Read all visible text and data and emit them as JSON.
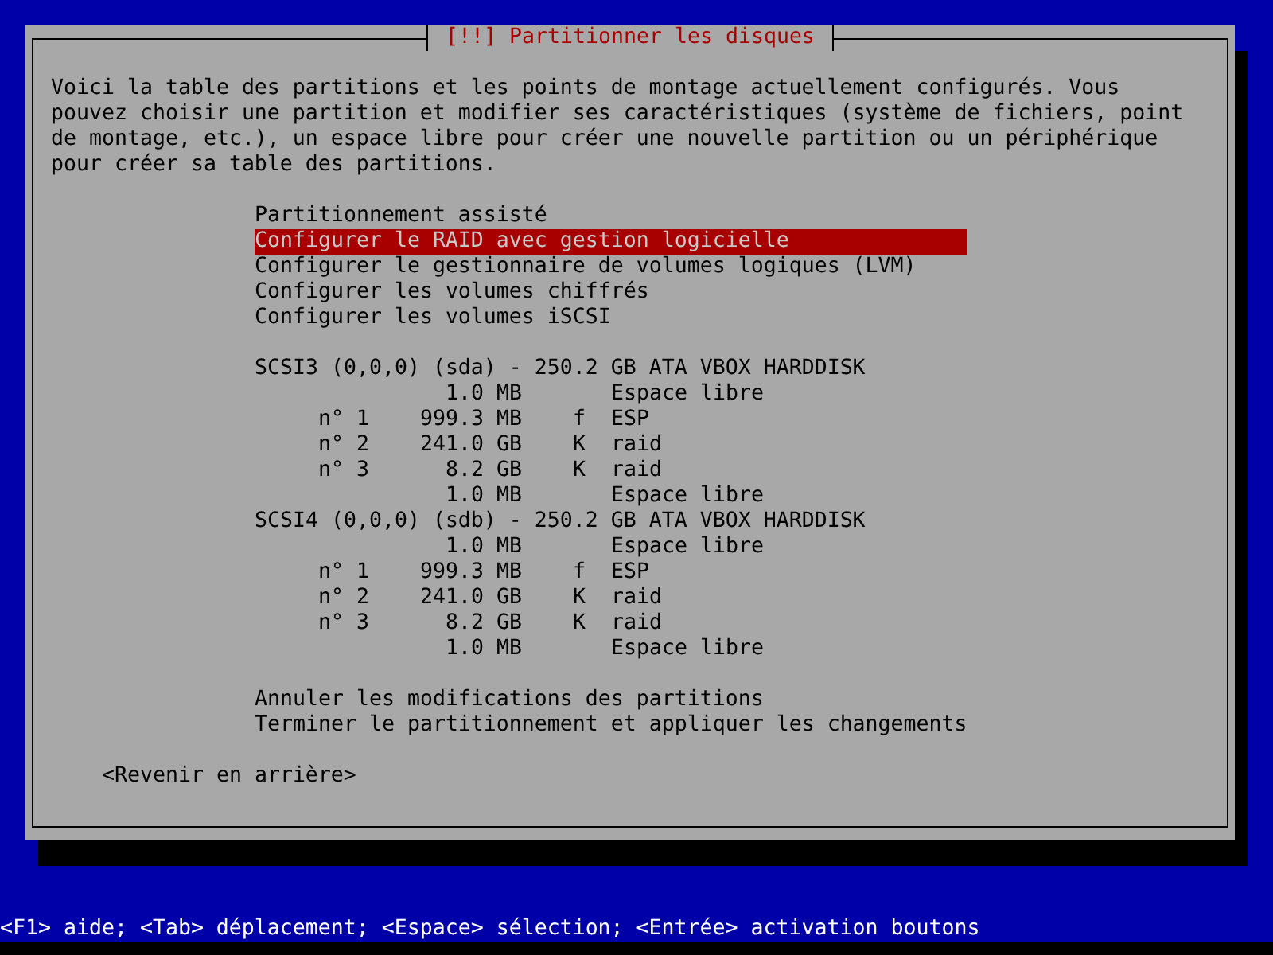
{
  "dialog": {
    "title": "[!!] Partitionner les disques",
    "description": "Voici la table des partitions et les points de montage actuellement configurés. Vous pouvez choisir une partition et modifier ses caractéristiques (système de fichiers, point de montage, etc.), un espace libre pour créer une nouvelle partition ou un périphérique pour créer sa table des partitions.",
    "menu": [
      {
        "label": "Partitionnement assisté",
        "selected": false
      },
      {
        "label": "Configurer le RAID avec gestion logicielle",
        "selected": true
      },
      {
        "label": "Configurer le gestionnaire de volumes logiques (LVM)",
        "selected": false
      },
      {
        "label": "Configurer les volumes chiffrés",
        "selected": false
      },
      {
        "label": "Configurer les volumes iSCSI",
        "selected": false
      }
    ],
    "disks": [
      {
        "label": "SCSI3 (0,0,0) (sda) - 250.2 GB ATA VBOX HARDDISK",
        "selected": false,
        "entries": [
          {
            "kind": "free",
            "size": "1.0 MB",
            "name": "Espace libre",
            "selected": false
          },
          {
            "kind": "partition",
            "number": "n° 1",
            "size": "999.3 MB",
            "flag": "f",
            "name": "ESP",
            "selected": false
          },
          {
            "kind": "partition",
            "number": "n° 2",
            "size": "241.0 GB",
            "flag": "K",
            "name": "raid",
            "selected": false
          },
          {
            "kind": "partition",
            "number": "n° 3",
            "size": "8.2 GB",
            "flag": "K",
            "name": "raid",
            "selected": false
          },
          {
            "kind": "free",
            "size": "1.0 MB",
            "name": "Espace libre",
            "selected": false
          }
        ]
      },
      {
        "label": "SCSI4 (0,0,0) (sdb) - 250.2 GB ATA VBOX HARDDISK",
        "selected": false,
        "entries": [
          {
            "kind": "free",
            "size": "1.0 MB",
            "name": "Espace libre",
            "selected": false
          },
          {
            "kind": "partition",
            "number": "n° 1",
            "size": "999.3 MB",
            "flag": "f",
            "name": "ESP",
            "selected": false
          },
          {
            "kind": "partition",
            "number": "n° 2",
            "size": "241.0 GB",
            "flag": "K",
            "name": "raid",
            "selected": false
          },
          {
            "kind": "partition",
            "number": "n° 3",
            "size": "8.2 GB",
            "flag": "K",
            "name": "raid",
            "selected": false
          },
          {
            "kind": "free",
            "size": "1.0 MB",
            "name": "Espace libre",
            "selected": false
          }
        ]
      }
    ],
    "actions": [
      {
        "label": "Annuler les modifications des partitions",
        "selected": false
      },
      {
        "label": "Terminer le partitionnement et appliquer les changements",
        "selected": false
      }
    ],
    "back_button": "<Revenir en arrière>"
  },
  "help_bar": "<F1> aide; <Tab> déplacement; <Espace> sélection; <Entrée> activation boutons"
}
